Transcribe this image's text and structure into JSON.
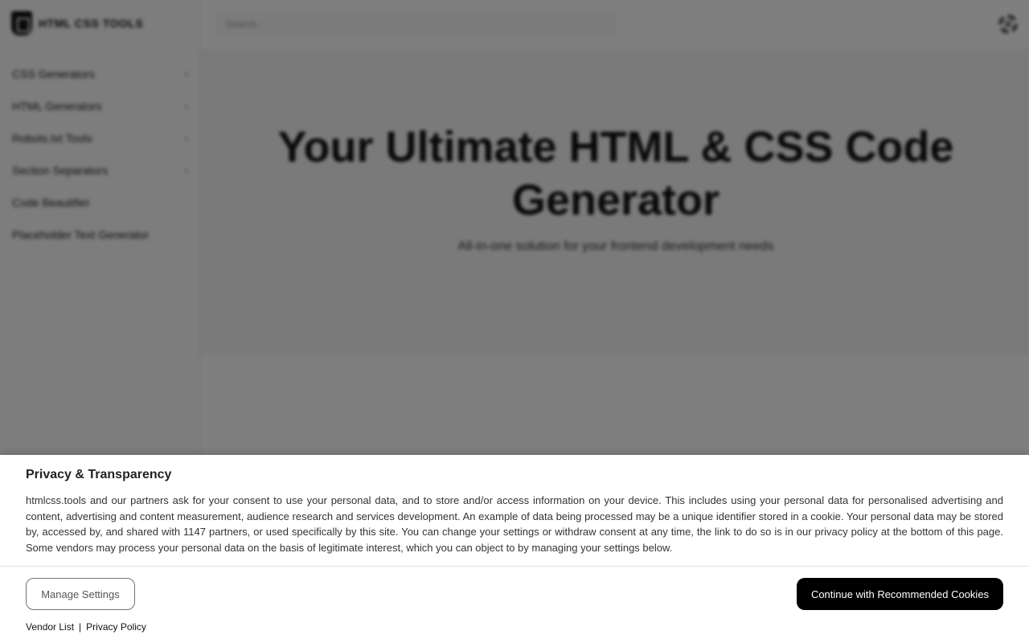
{
  "site": {
    "logo_text": "HTML CSS TOOLS",
    "search_placeholder": "Search...",
    "sidebar": {
      "items": [
        {
          "label": "CSS Generators",
          "chevron": "›"
        },
        {
          "label": "HTML Generators",
          "chevron": "›"
        },
        {
          "label": "Robots.txt Tools",
          "chevron": "›"
        },
        {
          "label": "Section Separators",
          "chevron": "›"
        },
        {
          "label": "Code Beautifier",
          "chevron": ""
        },
        {
          "label": "Placeholder Text Generator",
          "chevron": ""
        }
      ]
    },
    "hero": {
      "title": "Your Ultimate HTML & CSS Code Generator",
      "subtitle": "All-in-one solution for your frontend development needs"
    }
  },
  "consent": {
    "title": "Privacy & Transparency",
    "body": "htmlcss.tools and our partners ask for your consent to use your personal data, and to store and/or access information on your device. This includes using your personal data for personalised advertising and content, advertising and content measurement, audience research and services development. An example of data being processed may be a unique identifier stored in a cookie. Your personal data may be stored by, accessed by, and shared with 1147 partners, or used specifically by this site. You can change your settings or withdraw consent at any time, the link to do so is in our privacy policy at the bottom of this page. Some vendors may process your personal data on the basis of legitimate interest, which you can object to by managing your settings below.",
    "manage_label": "Manage Settings",
    "continue_label": "Continue with Recommended Cookies",
    "vendor_list_label": "Vendor List",
    "separator": "|",
    "privacy_policy_label": "Privacy Policy"
  },
  "colors": {
    "overlay": "rgba(0,0,0,0.5)",
    "primary_button": "#000000",
    "banner_background": "#ffffff"
  }
}
